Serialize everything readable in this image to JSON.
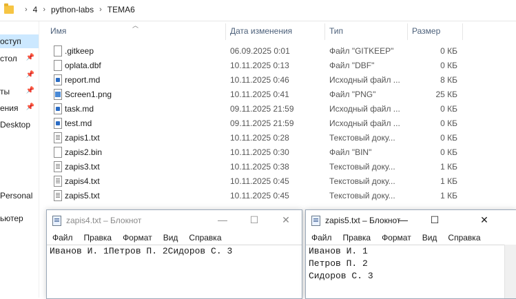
{
  "breadcrumb": {
    "items": [
      "4",
      "python-labs",
      "TEMA6"
    ]
  },
  "nav": {
    "items": [
      {
        "label": "оступ",
        "pinned": false,
        "selected": true
      },
      {
        "label": "стол",
        "pinned": true,
        "selected": false
      },
      {
        "label": "",
        "pinned": true,
        "selected": false
      },
      {
        "label": "ты",
        "pinned": true,
        "selected": false
      },
      {
        "label": "ения",
        "pinned": true,
        "selected": false
      },
      {
        "label": "Desktop",
        "pinned": false,
        "selected": false
      },
      {
        "label": "Personal",
        "pinned": false,
        "selected": false
      },
      {
        "label": "ьютер",
        "pinned": false,
        "selected": false
      }
    ]
  },
  "columns": {
    "name": "Имя",
    "date": "Дата изменения",
    "type": "Тип",
    "size": "Размер"
  },
  "files": [
    {
      "icon": "generic",
      "name": ".gitkeep",
      "date": "06.09.2025 0:01",
      "type": "Файл \"GITKEEP\"",
      "size": "0 КБ"
    },
    {
      "icon": "generic",
      "name": "oplata.dbf",
      "date": "10.11.2025 0:13",
      "type": "Файл \"DBF\"",
      "size": "0 КБ"
    },
    {
      "icon": "md",
      "name": "report.md",
      "date": "10.11.2025 0:46",
      "type": "Исходный файл ...",
      "size": "8 КБ"
    },
    {
      "icon": "png",
      "name": "Screen1.png",
      "date": "10.11.2025 0:41",
      "type": "Файл \"PNG\"",
      "size": "25 КБ"
    },
    {
      "icon": "md",
      "name": "task.md",
      "date": "09.11.2025 21:59",
      "type": "Исходный файл ...",
      "size": "0 КБ"
    },
    {
      "icon": "md",
      "name": "test.md",
      "date": "09.11.2025 21:59",
      "type": "Исходный файл ...",
      "size": "0 КБ"
    },
    {
      "icon": "txt",
      "name": "zapis1.txt",
      "date": "10.11.2025 0:28",
      "type": "Текстовый доку...",
      "size": "0 КБ"
    },
    {
      "icon": "generic",
      "name": "zapis2.bin",
      "date": "10.11.2025 0:30",
      "type": "Файл \"BIN\"",
      "size": "0 КБ"
    },
    {
      "icon": "txt",
      "name": "zapis3.txt",
      "date": "10.11.2025 0:38",
      "type": "Текстовый доку...",
      "size": "1 КБ"
    },
    {
      "icon": "txt",
      "name": "zapis4.txt",
      "date": "10.11.2025 0:45",
      "type": "Текстовый доку...",
      "size": "1 КБ"
    },
    {
      "icon": "txt",
      "name": "zapis5.txt",
      "date": "10.11.2025 0:45",
      "type": "Текстовый доку...",
      "size": "1 КБ"
    }
  ],
  "notepad1": {
    "title": "zapis4.txt – Блокнот",
    "menu": [
      "Файл",
      "Правка",
      "Формат",
      "Вид",
      "Справка"
    ],
    "lines": [
      "Иванов И. 1Петров П. 2Сидоров С. 3"
    ],
    "controls": {
      "minimize": "—",
      "maximize": "☐",
      "close": "✕"
    }
  },
  "notepad2": {
    "title": "zapis5.txt – Блокнот",
    "menu": [
      "Файл",
      "Правка",
      "Формат",
      "Вид",
      "Справка"
    ],
    "lines": [
      "Иванов И. 1",
      "Петров П. 2",
      "Сидоров С. 3"
    ],
    "controls": {
      "minimize": "—",
      "maximize": "☐",
      "close": "✕"
    }
  },
  "colors": {
    "selection": "#cce8ff",
    "header_text": "#4c607a"
  }
}
